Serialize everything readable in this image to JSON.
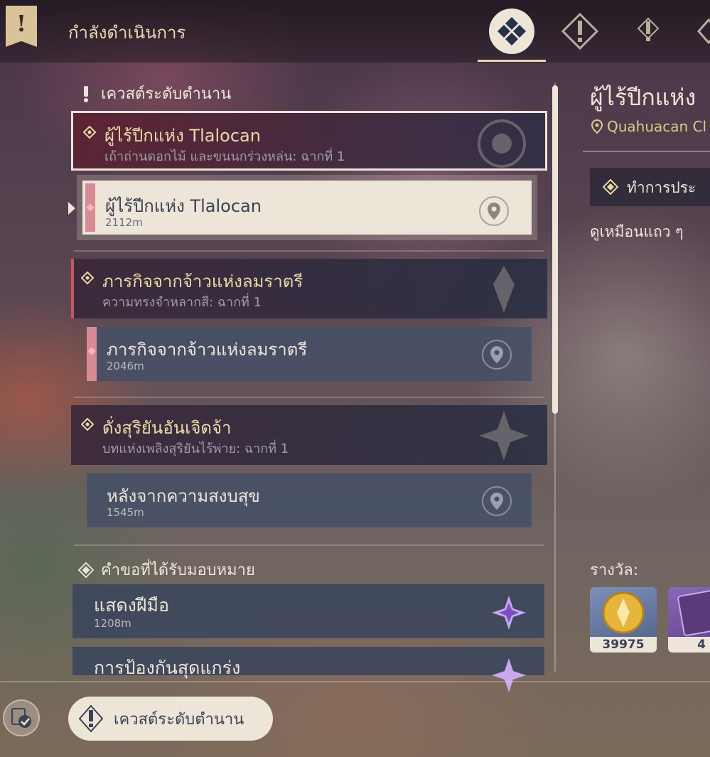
{
  "header": {
    "title": "กำลังดำเนินการ",
    "tabs": [
      {
        "name": "all-quests",
        "active": true
      },
      {
        "name": "archon-quests",
        "active": false
      },
      {
        "name": "legend-quests",
        "active": false
      },
      {
        "name": "world-quests",
        "active": false
      }
    ]
  },
  "sections": {
    "legend_header": "เควสต์ระดับตำนาน",
    "request_header": "คำขอที่ได้รับมอบหมาย"
  },
  "quests": [
    {
      "title": "ผู้ไร้ปีกแห่ง Tlalocan",
      "subtitle": "เถ้าถ่านดอกไม้ และขนนกร่วงหล่น: ฉากที่ 1",
      "selected": true,
      "objective": {
        "title": "ผู้ไร้ปีกแห่ง Tlalocan",
        "distance": "2112m",
        "tracked": true
      }
    },
    {
      "title": "ภารกิจจากจ้าวแห่งลมราตรี",
      "subtitle": "ความทรงจำหลากสี: ฉากที่ 1",
      "selected": false,
      "objective": {
        "title": "ภารกิจจากจ้าวแห่งลมราตรี",
        "distance": "2046m",
        "tracked": true
      }
    },
    {
      "title": "ดั่งสุริยันอันเจิดจ้า",
      "subtitle": "บทแห่งเพลิงสุริยันไร้พ่าย: ฉากที่ 1",
      "selected": false,
      "objective": {
        "title": "หลังจากความสงบสุข",
        "distance": "1545m",
        "tracked": false
      }
    }
  ],
  "requests": [
    {
      "title": "แสดงฝีมือ",
      "distance": "1208m"
    },
    {
      "title": "การป้องกันสุดแกร่ง",
      "distance": ""
    }
  ],
  "detail": {
    "title": "ผู้ไร้ปีกแห่ง",
    "location": "Quahuacan Cl",
    "objective": "ทำการประ",
    "description": "ดูเหมือนแถว ๆ",
    "reward_label": "รางวัล:",
    "rewards": [
      {
        "name": "mora",
        "amount": "39975"
      },
      {
        "name": "book",
        "amount": "4"
      }
    ]
  },
  "footer": {
    "filter_label": "เควสต์ระดับตำนาน"
  },
  "colors": {
    "accent": "#ece5d8",
    "gold": "#ecd9a8",
    "pink": "#d88b96",
    "panel": "#3c465c"
  }
}
